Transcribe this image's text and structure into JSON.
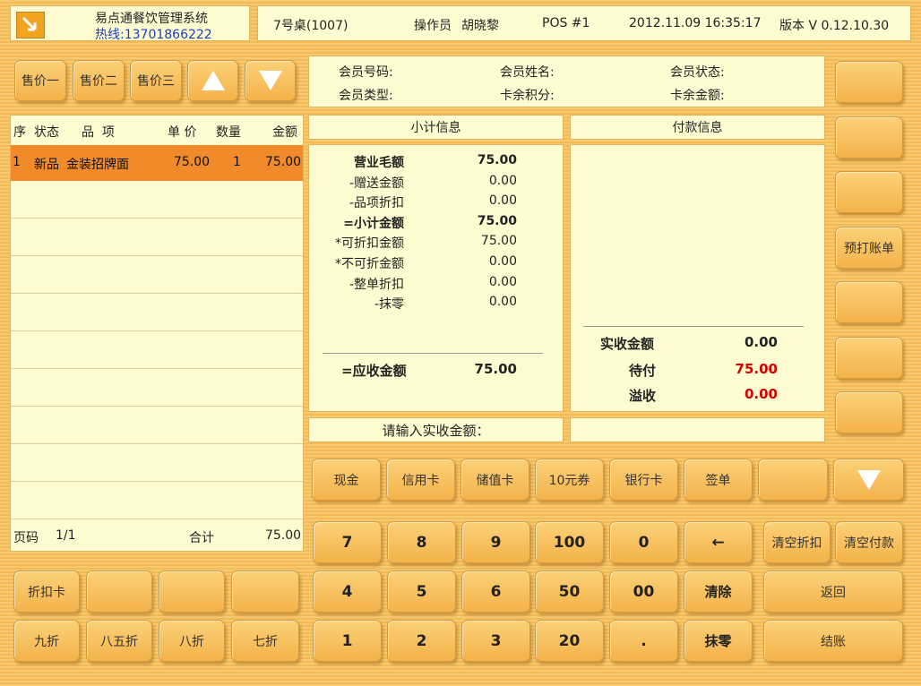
{
  "app": {
    "title": "易点通餐饮管理系统",
    "hotline": "热线:13701866222"
  },
  "header": {
    "table": "7号桌(1007)",
    "operator_label": "操作员",
    "operator_name": "胡晓黎",
    "pos": "POS #1",
    "datetime": "2012.11.09 16:35:17",
    "version": "版本 V 0.12.10.30"
  },
  "price_buttons": [
    "售价一",
    "售价二",
    "售价三"
  ],
  "order_table": {
    "headers": {
      "seq": "序",
      "status": "状态",
      "item": "品  项",
      "price": "单 价",
      "qty": "数量",
      "amount": "金额"
    },
    "rows": [
      {
        "seq": "1",
        "status": "新品",
        "item": "金装招牌面",
        "price": "75.00",
        "qty": "1",
        "amount": "75.00"
      }
    ],
    "page_label": "页码",
    "page_value": "1/1",
    "total_label": "合计",
    "total_value": "75.00"
  },
  "member": {
    "number_label": "会员号码:",
    "name_label": "会员姓名:",
    "status_label": "会员状态:",
    "type_label": "会员类型:",
    "points_label": "卡余积分:",
    "balance_label": "卡余金额:"
  },
  "subtotal": {
    "header": "小计信息",
    "lines": [
      {
        "label": "营业毛额",
        "value": "75.00",
        "bold": true
      },
      {
        "label": "-赠送金额",
        "value": "0.00",
        "bold": false
      },
      {
        "label": "-品项折扣",
        "value": "0.00",
        "bold": false
      },
      {
        "label": "=小计金额",
        "value": "75.00",
        "bold": true
      },
      {
        "label": "*可折扣金额",
        "value": "75.00",
        "bold": false
      },
      {
        "label": "*不可折金额",
        "value": "0.00",
        "bold": false
      },
      {
        "label": "-整单折扣",
        "value": "0.00",
        "bold": false
      },
      {
        "label": "-抹零",
        "value": "0.00",
        "bold": false
      }
    ],
    "receivable_label": "=应收金额",
    "receivable_value": "75.00"
  },
  "payment": {
    "header": "付款信息",
    "received_label": "实收金额",
    "received_value": "0.00",
    "pending_label": "待付",
    "pending_value": "75.00",
    "overflow_label": "溢收",
    "overflow_value": "0.00",
    "red_color": "#d40000"
  },
  "input_prompt": "请输入实收金额：",
  "pay_methods": [
    "现金",
    "信用卡",
    "储值卡",
    "10元券",
    "银行卡",
    "签单"
  ],
  "right_column": [
    "",
    "",
    "",
    "预打账单",
    "",
    "",
    ""
  ],
  "keypad": {
    "row1": [
      "7",
      "8",
      "9",
      "100",
      "0",
      "←"
    ],
    "row2": [
      "4",
      "5",
      "6",
      "50",
      "00",
      "清除"
    ],
    "row3": [
      "1",
      "2",
      "3",
      "20",
      ".",
      "抹零"
    ]
  },
  "actions": {
    "clear_discount": "清空折扣",
    "clear_payment": "清空付款",
    "back": "返回",
    "checkout": "结账"
  },
  "discount_buttons": {
    "row1": [
      "折扣卡",
      "",
      "",
      ""
    ],
    "row2": [
      "九折",
      "八五折",
      "八折",
      "七折"
    ]
  },
  "colors": {
    "selected_row": "#f08a2a",
    "panel_bg": "#fffcd2",
    "button": "#f7be5a"
  }
}
